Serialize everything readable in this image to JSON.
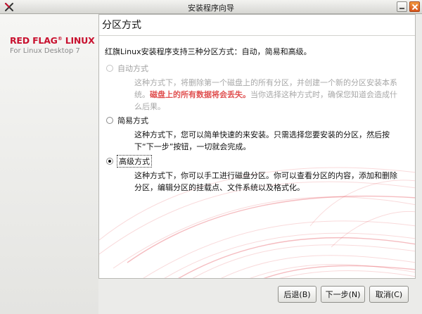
{
  "window": {
    "title": "安装程序向导"
  },
  "brand": {
    "name": "RED FLAG",
    "reg": "®",
    "linux": " LINUX",
    "subtitle": "For Linux Desktop 7"
  },
  "page": {
    "title": "分区方式",
    "intro": "红旗Linux安装程序支持三种分区方式：自动，简易和高级。"
  },
  "options": [
    {
      "label": "自动方式",
      "selected": false,
      "enabled": false,
      "desc_part1": "这种方式下，将删除第一个磁盘上的所有分区，并创建一个新的分区安装本系统。",
      "desc_warning": "磁盘上的所有数据将会丢失。",
      "desc_part2": "当你选择这种方式时，确保您知道会造成什么后果。"
    },
    {
      "label": "简易方式",
      "selected": false,
      "enabled": true,
      "desc": "这种方式下，您可以简单快速的来安装。只需选择您要安装的分区，然后按下“下一步”按钮，一切就会完成。"
    },
    {
      "label": "高级方式",
      "selected": true,
      "enabled": true,
      "desc": "这种方式下，你可以手工进行磁盘分区。你可以查看分区的内容，添加和删除分区，编辑分区的挂载点、文件系统以及格式化。"
    }
  ],
  "buttons": {
    "back": "后退(B)",
    "next": "下一步(N)",
    "cancel": "取消(C)"
  },
  "colors": {
    "brand_red": "#c8102e",
    "warning_red": "#e05050"
  }
}
